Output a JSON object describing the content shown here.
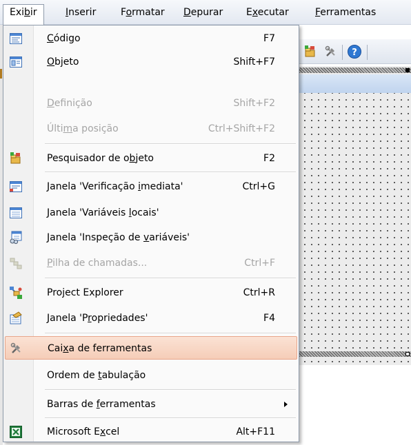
{
  "menubar": {
    "items": [
      {
        "pre": "Exi",
        "key": "b",
        "post": "ir"
      },
      {
        "pre": "",
        "key": "I",
        "post": "nserir"
      },
      {
        "pre": "F",
        "key": "o",
        "post": "rmatar"
      },
      {
        "pre": "",
        "key": "D",
        "post": "epurar"
      },
      {
        "pre": "E",
        "key": "x",
        "post": "ecutar"
      },
      {
        "pre": "",
        "key": "F",
        "post": "erramentas"
      }
    ]
  },
  "menu": {
    "items": [
      {
        "pre": "",
        "key": "C",
        "post": "ódigo",
        "shortcut": "F7"
      },
      {
        "pre": "",
        "key": "O",
        "post": "bjeto",
        "shortcut": "Shift+F7"
      },
      {
        "pre": "",
        "key": "D",
        "post": "efinição",
        "shortcut": "Shift+F2"
      },
      {
        "pre": "Últi",
        "key": "m",
        "post": "a posição",
        "shortcut": "Ctrl+Shift+F2"
      },
      {
        "pre": "Pesquisador de o",
        "key": "b",
        "post": "jeto",
        "shortcut": "F2"
      },
      {
        "pre": "Janela 'Verificação ",
        "key": "i",
        "post": "mediata'",
        "shortcut": "Ctrl+G"
      },
      {
        "pre": "Janela 'Variáveis ",
        "key": "l",
        "post": "ocais'",
        "shortcut": ""
      },
      {
        "pre": "Janela 'Inspeção de ",
        "key": "v",
        "post": "ariáveis'",
        "shortcut": ""
      },
      {
        "pre": "",
        "key": "P",
        "post": "ilha de chamadas...",
        "shortcut": "Ctrl+F"
      },
      {
        "pre": "Pro",
        "key": "j",
        "post": "ect Explorer",
        "shortcut": "Ctrl+R"
      },
      {
        "pre": "Janela 'P",
        "key": "r",
        "post": "opriedades'",
        "shortcut": "F4"
      },
      {
        "pre": "Cai",
        "key": "x",
        "post": "a de ferramentas",
        "shortcut": ""
      },
      {
        "pre": "Ordem de ",
        "key": "t",
        "post": "abulação",
        "shortcut": ""
      },
      {
        "pre": "Barras de ",
        "key": "f",
        "post": "erramentas",
        "shortcut": ""
      },
      {
        "pre": "Microsoft E",
        "key": "x",
        "post": "cel",
        "shortcut": "Alt+F11"
      }
    ]
  },
  "toolbar": {
    "icons": [
      "object-browser-icon",
      "toolbox-icon",
      "help-icon"
    ]
  },
  "colors": {
    "highlight": "#f5cdb8",
    "highlight_border": "#e8a58a",
    "disabled_text": "#a5a5a5",
    "menubar_bg": "#e3e8f1"
  }
}
